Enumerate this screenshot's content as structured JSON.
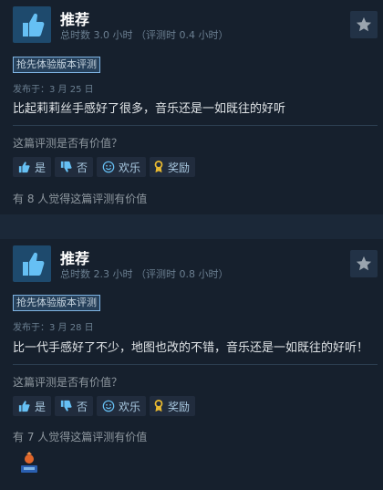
{
  "reviews": [
    {
      "verdict": "推荐",
      "hours": "总时数 3.0 小时 （评测时 0.4 小时）",
      "badge": "抢先体验版本评测",
      "posted": "发布于：3 月 25 日",
      "text": "比起莉莉丝手感好了很多，音乐还是一如既往的好听",
      "helpful_question": "这篇评测是否有价值？",
      "buttons": {
        "yes": "是",
        "no": "否",
        "funny": "欢乐",
        "award": "奖励"
      },
      "helpful_count": "有 8 人觉得这篇评测有价值"
    },
    {
      "verdict": "推荐",
      "hours": "总时数 2.3 小时 （评测时 0.8 小时）",
      "badge": "抢先体验版本评测",
      "posted": "发布于：3 月 28 日",
      "text": "比一代手感好了不少，地图也改的不错，音乐还是一如既往的好听！",
      "helpful_question": "这篇评测是否有价值？",
      "buttons": {
        "yes": "是",
        "no": "否",
        "funny": "欢乐",
        "award": "奖励"
      },
      "helpful_count": "有 7 人觉得这篇评测有价值",
      "award_icon": "award-trophy-icon"
    }
  ],
  "icons": {
    "recommend": "thumbs-up-icon",
    "star": "star-icon",
    "yes": "thumb-up-icon",
    "no": "thumb-down-icon",
    "funny": "smile-icon",
    "award": "ribbon-icon"
  },
  "colors": {
    "page_bg": "#1b2838",
    "card_bg": "#16202d",
    "accent": "#66c0f4",
    "thumb_bg": "#1e4a6d"
  }
}
